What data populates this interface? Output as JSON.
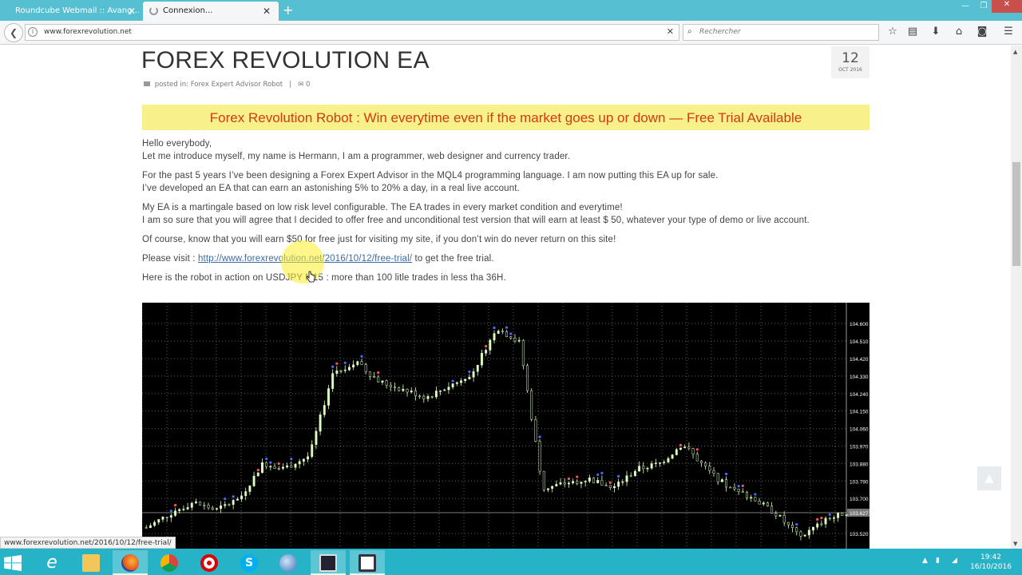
{
  "browser": {
    "tabs": [
      {
        "label": "Roundcube Webmail :: Avang...",
        "active": false
      },
      {
        "label": "Connexion...",
        "active": true
      }
    ],
    "new_tab_icon": "plus-icon",
    "url": "www.forexrevolution.net",
    "search_placeholder": "Rechercher",
    "toolbar_icons": [
      "star-icon",
      "reading-list-icon",
      "download-icon",
      "home-icon",
      "pocket-icon",
      "menu-icon"
    ]
  },
  "post": {
    "title": "FOREX REVOLUTION EA",
    "date_day": "12",
    "date_month": "OCT 2016",
    "meta_posted": "posted in:",
    "meta_category": "Forex Expert Advisor Robot",
    "meta_separator": "|",
    "meta_comments": "0",
    "banner": "Forex Revolution Robot : Win everytime even if the market goes up or down — Free Trial Available",
    "p1_line1": "Hello everybody,",
    "p1_line2": "Let me introduce myself, my name is Hermann, I am a programmer, web designer and currency trader.",
    "p2_line1": "For the past 5 years I’ve been designing a Forex Expert Advisor in the MQL4 programming language. I am now putting this EA up for sale.",
    "p2_line2": "I’ve developed an EA that can earn an astonishing 5% to 20% a day, in a real live account.",
    "p3_line1": "My EA is a martingale based on low risk level configurable. The EA trades in every market condition and everytime!",
    "p3_line2": "I am so sure that you will agree that I decided to offer free and unconditional test version that will earn at least $ 50, whatever your type of demo or live account.",
    "p4": "Of course, know that you will earn $50 for free just for visiting my site, if you don’t win do never return on this site!",
    "p5_prefix": "Please visit :",
    "p5_link": "http://www.forexrevolution.net/2016/10/12/free-trial/",
    "p5_suffix": "to get the free trial.",
    "p6": "Here is the robot in action on USDJPY M15 : more than 100 litle trades in less tha 36H."
  },
  "chart_data": {
    "type": "candlestick",
    "symbol": "USDJPY",
    "timeframe": "M15",
    "y_tick_labels": [
      "104.600",
      "104.510",
      "104.420",
      "104.330",
      "104.240",
      "104.150",
      "104.060",
      "103.970",
      "103.880",
      "103.790",
      "103.700",
      "103.627",
      "103.520"
    ],
    "current_price_label": "103.627",
    "ylim": [
      103.45,
      104.65
    ],
    "approx_close_path": [
      103.55,
      103.62,
      103.68,
      103.64,
      103.7,
      103.88,
      103.86,
      103.92,
      104.35,
      104.4,
      104.3,
      104.26,
      104.22,
      104.28,
      104.35,
      104.58,
      104.5,
      103.75,
      103.78,
      103.8,
      103.75,
      103.85,
      103.88,
      103.98,
      103.85,
      103.75,
      103.7,
      103.62,
      103.5,
      103.58,
      103.63
    ],
    "colors": {
      "background": "#000000",
      "bull": "#dcffc0",
      "bear": "#000000",
      "grid": "#5a5a5a"
    }
  },
  "status_url": "www.forexrevolution.net/2016/10/12/free-trial/",
  "taskbar": {
    "apps": [
      "internet-explorer-icon",
      "file-explorer-icon",
      "firefox-icon",
      "chrome-icon",
      "opera-icon",
      "skype-icon",
      "thunderbird-icon",
      "metatrader-icon",
      "window-icon"
    ],
    "time": "19:42",
    "date": "16/10/2016"
  }
}
